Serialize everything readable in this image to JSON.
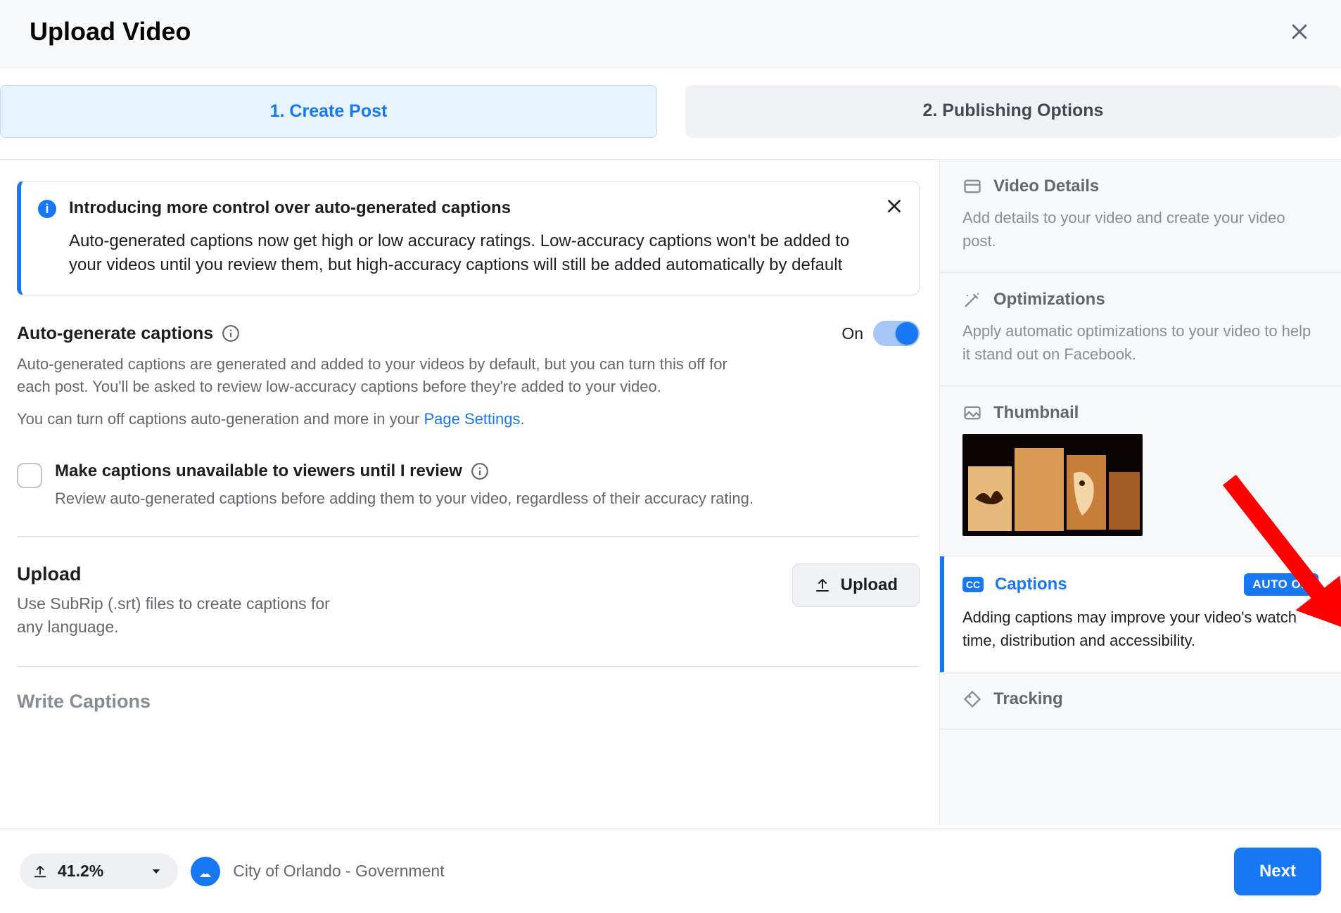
{
  "header": {
    "title": "Upload Video"
  },
  "tabs": {
    "create": "1. Create Post",
    "publish": "2. Publishing Options"
  },
  "banner": {
    "title": "Introducing more control over auto-generated captions",
    "body": "Auto-generated captions now get high or low accuracy ratings. Low-accuracy captions won't be added to your videos until you review them, but high-accuracy captions will still be added automatically by default"
  },
  "autogen": {
    "title": "Auto-generate captions",
    "toggle_state": "On",
    "desc1": "Auto-generated captions are generated and added to your videos by default, but you can turn this off for each post. You'll be asked to review low-accuracy captions before they're added to your video.",
    "desc2_prefix": "You can turn off captions auto-generation and more in your ",
    "desc2_link": "Page Settings",
    "desc2_suffix": "."
  },
  "review_checkbox": {
    "label": "Make captions unavailable to viewers until I review",
    "desc": "Review auto-generated captions before adding them to your video, regardless of their accuracy rating."
  },
  "upload": {
    "title": "Upload",
    "desc": "Use SubRip (.srt) files to create captions for any language.",
    "button": "Upload"
  },
  "write": {
    "title": "Write Captions"
  },
  "sidebar": {
    "videodetails": {
      "title": "Video Details",
      "desc": "Add details to your video and create your video post."
    },
    "optimizations": {
      "title": "Optimizations",
      "desc": "Apply automatic optimizations to your video to help it stand out on Facebook."
    },
    "thumbnail": {
      "title": "Thumbnail"
    },
    "captions": {
      "title": "Captions",
      "badge": "AUTO ON",
      "desc": "Adding captions may improve your video's watch time, distribution and accessibility."
    },
    "tracking": {
      "title": "Tracking"
    }
  },
  "footer": {
    "progress": "41.2%",
    "page_name": "City of Orlando - Government",
    "next": "Next"
  }
}
